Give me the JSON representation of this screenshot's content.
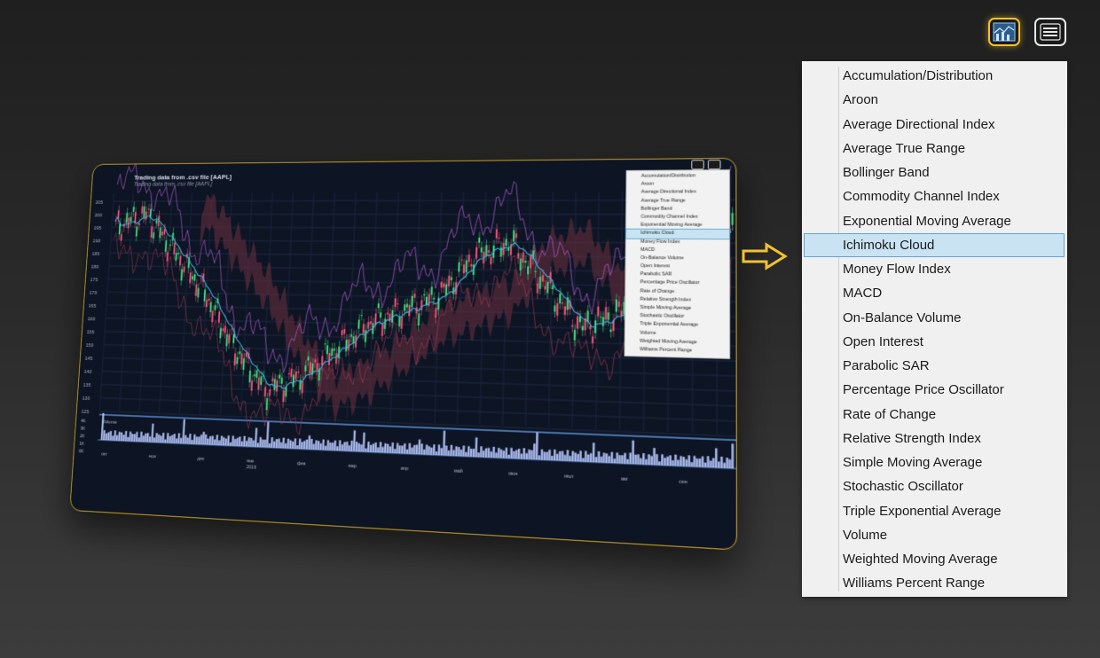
{
  "toolbar": {
    "indicators_icon": "bar-chart-icon",
    "menu_icon": "hamburger-menu-icon",
    "accent_color": "#f2c230"
  },
  "chart_panel": {
    "title": "Trading data from .csv file  [AAPL]",
    "subtitle": "Trading data from .csv file [AAPL]",
    "volume_label": "Volume",
    "price_ticks": [
      "205",
      "200",
      "195",
      "190",
      "185",
      "180",
      "175",
      "170",
      "165",
      "160",
      "155",
      "150",
      "145",
      "140",
      "135",
      "130",
      "125"
    ],
    "volume_ticks": [
      "4K",
      "3K",
      "2K",
      "1K",
      "0K"
    ],
    "month_labels": [
      "окт",
      "ноя",
      "дек",
      "янв",
      "фев",
      "мар",
      "апр",
      "май",
      "июн",
      "июл",
      "авг",
      "сен"
    ],
    "year_label": "2019",
    "colors": {
      "up": "#3fe07a",
      "down": "#ff4f7a",
      "sma": "#3fb6e6",
      "bollinger": "#b25fd6",
      "volume": "#b7c8ff",
      "cloud_up": "#2f6e4a",
      "cloud_down": "#6e2f3e"
    }
  },
  "indicator_menu": {
    "selected": "Ichimoku Cloud",
    "items": [
      "Accumulation/Distribution",
      "Aroon",
      "Average Directional Index",
      "Average True Range",
      "Bollinger Band",
      "Commodity Channel Index",
      "Exponential Moving Average",
      "Ichimoku Cloud",
      "Money Flow Index",
      "MACD",
      "On-Balance Volume",
      "Open Interest",
      "Parabolic SAR",
      "Percentage Price Oscillator",
      "Rate of Change",
      "Relative Strength Index",
      "Simple Moving Average",
      "Stochastic Oscillator",
      "Triple Exponential Average",
      "Volume",
      "Weighted Moving Average",
      "Williams Percent Range"
    ]
  },
  "arrow_icon": "right-arrow-icon"
}
